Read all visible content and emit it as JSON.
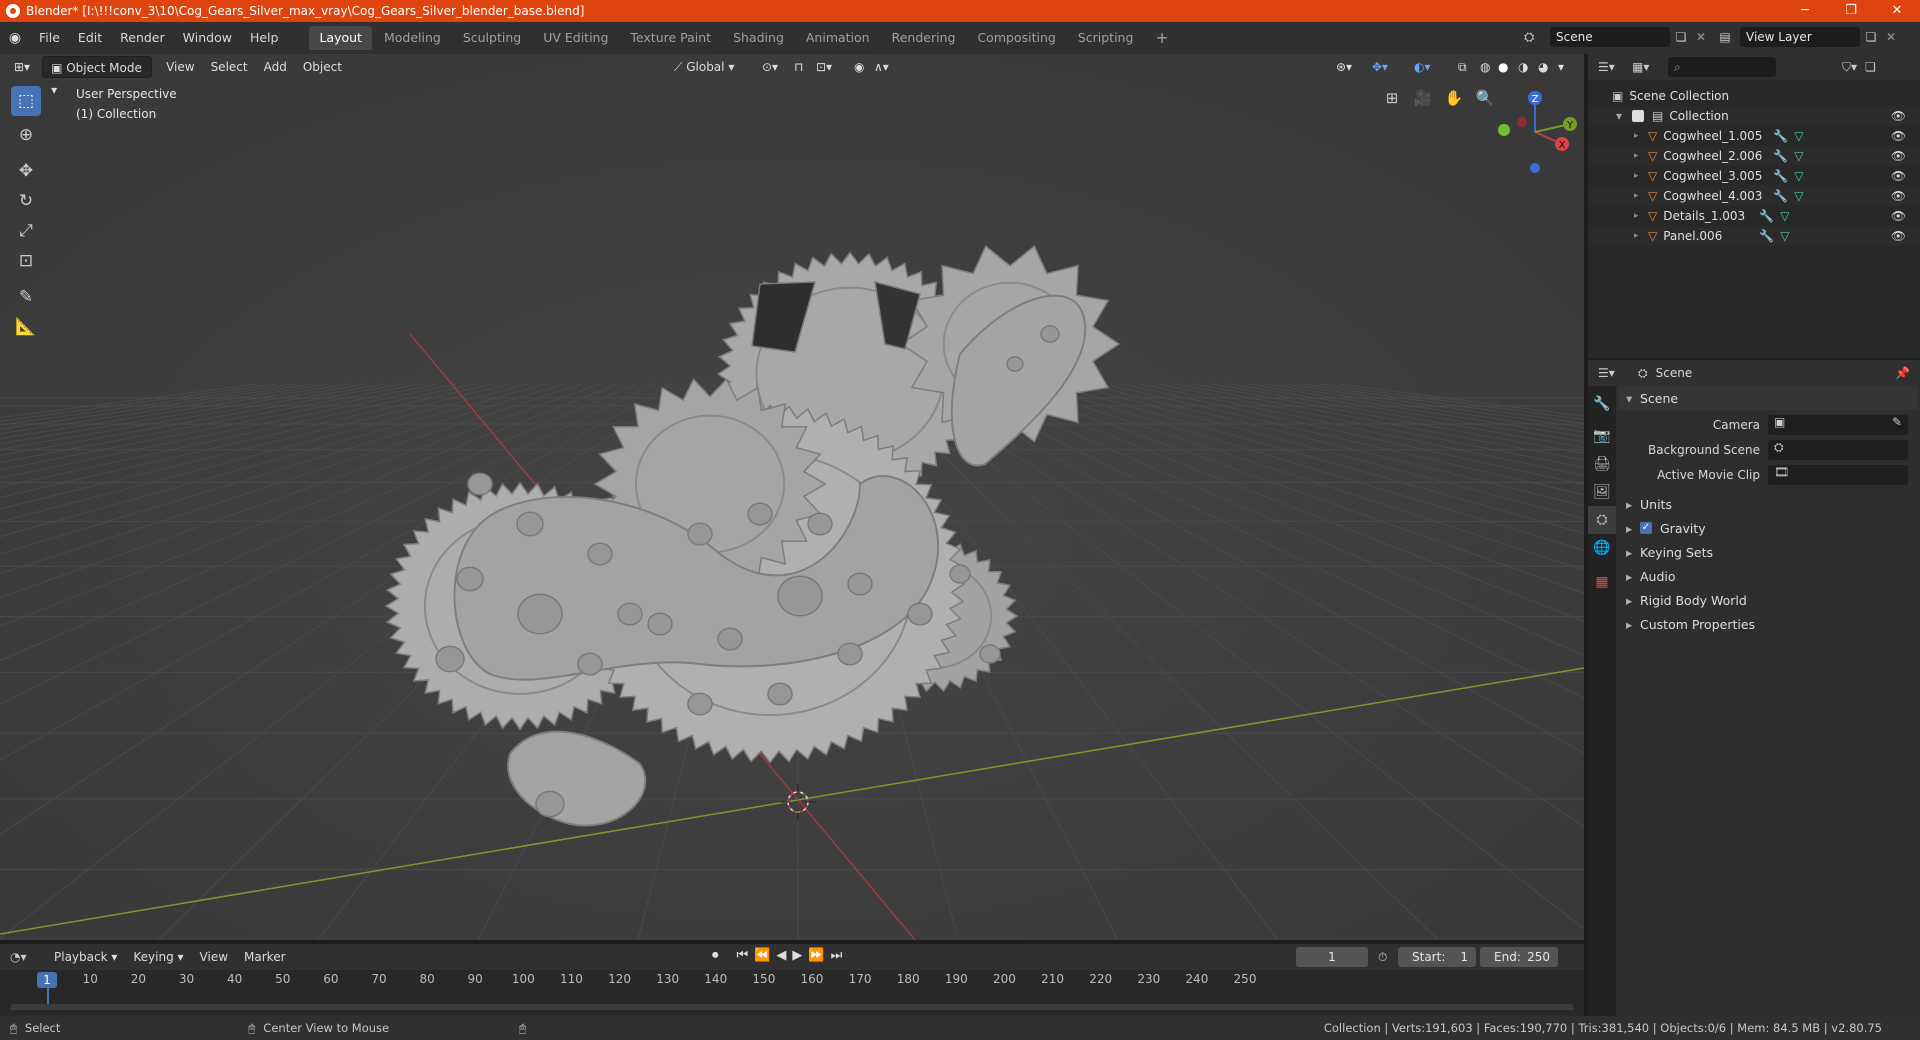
{
  "titlebar": {
    "title": "Blender* [I:\\!!!conv_3\\10\\Cog_Gears_Silver_max_vray\\Cog_Gears_Silver_blender_base.blend]",
    "minimize": "─",
    "restore": "❐",
    "close": "✕"
  },
  "menubar": {
    "menus": [
      "File",
      "Edit",
      "Render",
      "Window",
      "Help"
    ],
    "workspaces": [
      "Layout",
      "Modeling",
      "Sculpting",
      "UV Editing",
      "Texture Paint",
      "Shading",
      "Animation",
      "Rendering",
      "Compositing",
      "Scripting"
    ],
    "active_workspace": "Layout",
    "add_tab": "+",
    "scene": "Scene",
    "view_layer": "View Layer"
  },
  "viewport": {
    "mode": "Object Mode",
    "menus": [
      "View",
      "Select",
      "Add",
      "Object"
    ],
    "transform_orientation": "Global",
    "overlay_line1": "User Perspective",
    "overlay_line2": "(1) Collection",
    "gizmo_axes": {
      "z": "Z",
      "x": "X",
      "y": "Y"
    }
  },
  "outliner": {
    "search_placeholder": "",
    "scene_collection": "Scene Collection",
    "collection": "Collection",
    "objects": [
      {
        "name": "Cogwheel_1.005"
      },
      {
        "name": "Cogwheel_2.006"
      },
      {
        "name": "Cogwheel_3.005"
      },
      {
        "name": "Cogwheel_4.003"
      },
      {
        "name": "Details_1.003"
      },
      {
        "name": "Panel.006"
      }
    ]
  },
  "properties": {
    "context": "Scene",
    "panel_title": "Scene",
    "camera_label": "Camera",
    "background_scene_label": "Background Scene",
    "active_movie_clip_label": "Active Movie Clip",
    "sections": [
      "Units",
      "Gravity",
      "Keying Sets",
      "Audio",
      "Rigid Body World",
      "Custom Properties"
    ]
  },
  "timeline": {
    "menus": [
      "Playback",
      "Keying",
      "View",
      "Marker"
    ],
    "current_frame": "1",
    "start_label": "Start:",
    "start": "1",
    "end_label": "End:",
    "end": "250",
    "ticks": [
      "10",
      "20",
      "30",
      "40",
      "50",
      "60",
      "70",
      "80",
      "90",
      "100",
      "110",
      "120",
      "130",
      "140",
      "150",
      "160",
      "170",
      "180",
      "190",
      "200",
      "210",
      "220",
      "230",
      "240",
      "250"
    ],
    "playhead": "1"
  },
  "statusbar": {
    "left1": "Select",
    "left2": "Center View to Mouse",
    "stats": "Collection | Verts:191,603 | Faces:190,770 | Tris:381,540 | Objects:0/6 | Mem: 84.5 MB | v2.80.75"
  },
  "colors": {
    "titlebar": "#e0440e",
    "accent": "#4772b3",
    "x_axis": "#c83c3c",
    "y_axis": "#7a9a2c",
    "z_axis": "#3b6fd6"
  }
}
